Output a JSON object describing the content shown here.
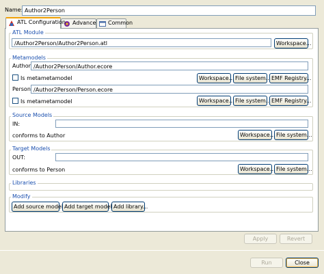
{
  "name": {
    "label": "Name:",
    "value": "Author2Person"
  },
  "tabs": [
    {
      "label": "ATL Configuration",
      "icon": "atl-config-icon"
    },
    {
      "label": "Advanced",
      "icon": "advanced-icon"
    },
    {
      "label": "Common",
      "icon": "common-icon"
    }
  ],
  "atl_module": {
    "title": "ATL Module",
    "path": "/Author2Person/Author2Person.atl",
    "workspace": "Workspace..."
  },
  "metamodels": {
    "title": "Metamodels",
    "author": {
      "label": "Author:",
      "path": "/Author2Person/Author.ecore",
      "checkbox": "Is metametamodel",
      "workspace": "Workspace...",
      "file_system": "File system...",
      "emf": "EMF Registry..."
    },
    "person": {
      "label": "Person:",
      "path": "/Author2Person/Person.ecore",
      "checkbox": "Is metametamodel",
      "workspace": "Workspace...",
      "file_system": "File system...",
      "emf": "EMF Registry..."
    }
  },
  "source_models": {
    "title": "Source Models",
    "in_label": "IN:",
    "in_value": "",
    "conforms": "conforms to Author",
    "workspace": "Workspace...",
    "file_system": "File system..."
  },
  "target_models": {
    "title": "Target Models",
    "out_label": "OUT:",
    "out_value": "",
    "conforms": "conforms to Person",
    "workspace": "Workspace...",
    "file_system": "File system..."
  },
  "libraries": {
    "title": "Libraries"
  },
  "modify": {
    "title": "Modify",
    "add_source": "Add source model...",
    "add_target": "Add target model...",
    "add_library": "Add library..."
  },
  "footer": {
    "apply": "Apply",
    "revert": "Revert",
    "run": "Run",
    "close": "Close"
  }
}
